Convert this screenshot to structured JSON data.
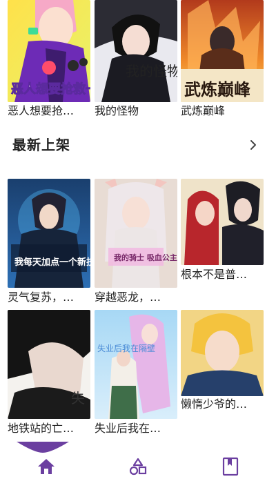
{
  "top_row": [
    {
      "title": "恶人想要抢…",
      "cover_text": "恶人想要抢救一下"
    },
    {
      "title": "我的怪物",
      "cover_text": "我的怪物"
    },
    {
      "title": "武炼巅峰",
      "cover_text": "武炼巅峰"
    }
  ],
  "section": {
    "title": "最新上架"
  },
  "grid": [
    {
      "title": "灵气复苏，…",
      "cover_text": "我每天加点一个新技能"
    },
    {
      "title": "穿越恶龙，…",
      "cover_text": "我的骑士 吸血公主"
    },
    {
      "title": "根本不是普…"
    },
    {
      "title": "地铁站的亡…",
      "cover_text": "失"
    },
    {
      "title": "失业后我在…",
      "cover_text": "失业后我在隔壁"
    },
    {
      "title": "懒惰少爷的…"
    }
  ],
  "nav": {
    "active": "home"
  },
  "colors": {
    "accent": "#6b3fa0"
  }
}
